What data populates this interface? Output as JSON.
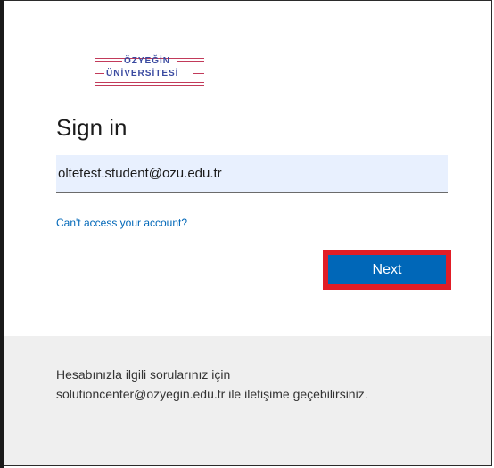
{
  "logo": {
    "line1": "ÖZYEĞİN",
    "line2": "ÜNİVERSİTESİ",
    "colors": {
      "text": "#3a4aa0",
      "stripes": "#c23a5a"
    }
  },
  "signin": {
    "title": "Sign in",
    "email_value": "oltetest.student@ozu.edu.tr",
    "cant_access_link": "Can't access your account?",
    "next_label": "Next"
  },
  "footer": {
    "message": "Hesabınızla ilgili sorularınız için solutioncenter@ozyegin.edu.tr ile iletişime geçebilirsiniz."
  },
  "colors": {
    "accent": "#0067b8",
    "highlight": "#e11d26",
    "field_bg": "#e8f0fe",
    "footer_bg": "#efefef"
  }
}
